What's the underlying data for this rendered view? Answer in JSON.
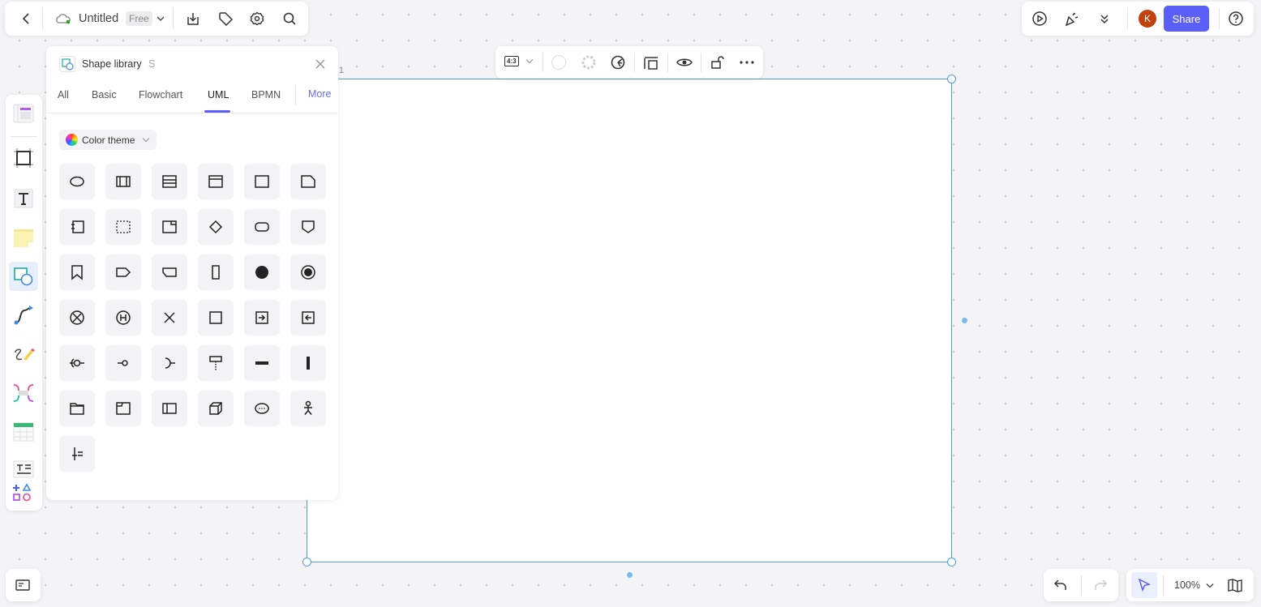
{
  "header": {
    "title": "Untitled",
    "plan_badge": "Free",
    "icons": [
      "back-icon",
      "cloud-icon",
      "download-icon",
      "tag-icon",
      "settings-icon",
      "search-icon"
    ]
  },
  "right_toolbar": {
    "avatar_letter": "K",
    "share_label": "Share",
    "icons": [
      "present-icon",
      "celebrate-icon",
      "expand-more-icon",
      "help-icon"
    ]
  },
  "frame_toolbar": {
    "ratio": "4:3",
    "icons": [
      "ratio-icon",
      "fill-color-icon",
      "border-icon",
      "theme-icon",
      "fit-content-icon",
      "preview-icon",
      "unlock-icon",
      "more-icon"
    ]
  },
  "frame": {
    "label": "1"
  },
  "shape_library": {
    "title": "Shape library",
    "shortcut": "S",
    "tabs": [
      "All",
      "Basic",
      "Flowchart",
      "UML",
      "BPMN"
    ],
    "active_tab": "UML",
    "more_label": "More",
    "color_theme_label": "Color theme",
    "shapes": [
      "ellipse",
      "class",
      "class-list",
      "interface",
      "rectangle",
      "note",
      "component",
      "dashed-rect",
      "package-box",
      "decision",
      "rounded-rect",
      "pentagon-down",
      "bookmark",
      "tag-right",
      "tag-notch",
      "tall-rect",
      "initial-state",
      "final-state",
      "flow-final",
      "history",
      "cross",
      "square",
      "send-signal",
      "receive-signal",
      "provided-interface",
      "required-lollipop",
      "socket",
      "pin-dotted",
      "fork-horizontal",
      "fork-vertical",
      "folder",
      "frame",
      "lifeline",
      "node",
      "use-case",
      "actor",
      "sequence-bar"
    ]
  },
  "left_toolbar": {
    "tools": [
      "templates",
      "frame",
      "text",
      "sticky-note",
      "shapes",
      "connector",
      "pen",
      "mind-map",
      "table",
      "text-list",
      "more-shapes"
    ],
    "active": "shapes"
  },
  "bottom": {
    "zoom": "100%",
    "icons": [
      "undo-icon",
      "redo-icon",
      "select-icon",
      "map-icon",
      "panel-icon"
    ]
  },
  "colors": {
    "accent": "#5b5ef8",
    "selection": "#4f9bea",
    "avatar": "#c2410c"
  }
}
